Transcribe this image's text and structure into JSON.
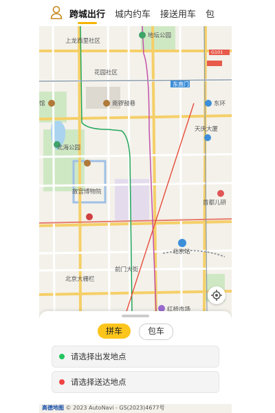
{
  "tabs": [
    {
      "label": "跨城出行",
      "active": true
    },
    {
      "label": "城内约车",
      "active": false
    },
    {
      "label": "接送用车",
      "active": false
    },
    {
      "label": "包",
      "active": false
    }
  ],
  "map": {
    "labels": {
      "ditan": "地坛公园",
      "shanglong": "上龙西里社区",
      "huayuan": "花园社区",
      "nanluo": "南锣鼓巷",
      "dongzhimen": "东直门",
      "dongsi": "东环",
      "tianxia": "天庆大厦",
      "beihai": "北海公园",
      "gugong": "故宫博物院",
      "shoudu": "首都儿研",
      "beijingzhan": "北京站",
      "qianmen": "前门大街",
      "dashilan": "北京大栅栏",
      "hongqiao": "红桥市场",
      "guan": "馆",
      "g101": "G101"
    }
  },
  "panel": {
    "mode_active": "拼车",
    "mode_inactive": "包车",
    "from_placeholder": "请选择出发地点",
    "to_placeholder": "请选择送达地点"
  },
  "attribution": {
    "logo": "高德地图",
    "text": "© 2023 AutoNavi - GS(2023)4677号"
  },
  "colors": {
    "accent": "#fbc51c",
    "from_dot": "#22c55e",
    "to_dot": "#ef4444"
  }
}
